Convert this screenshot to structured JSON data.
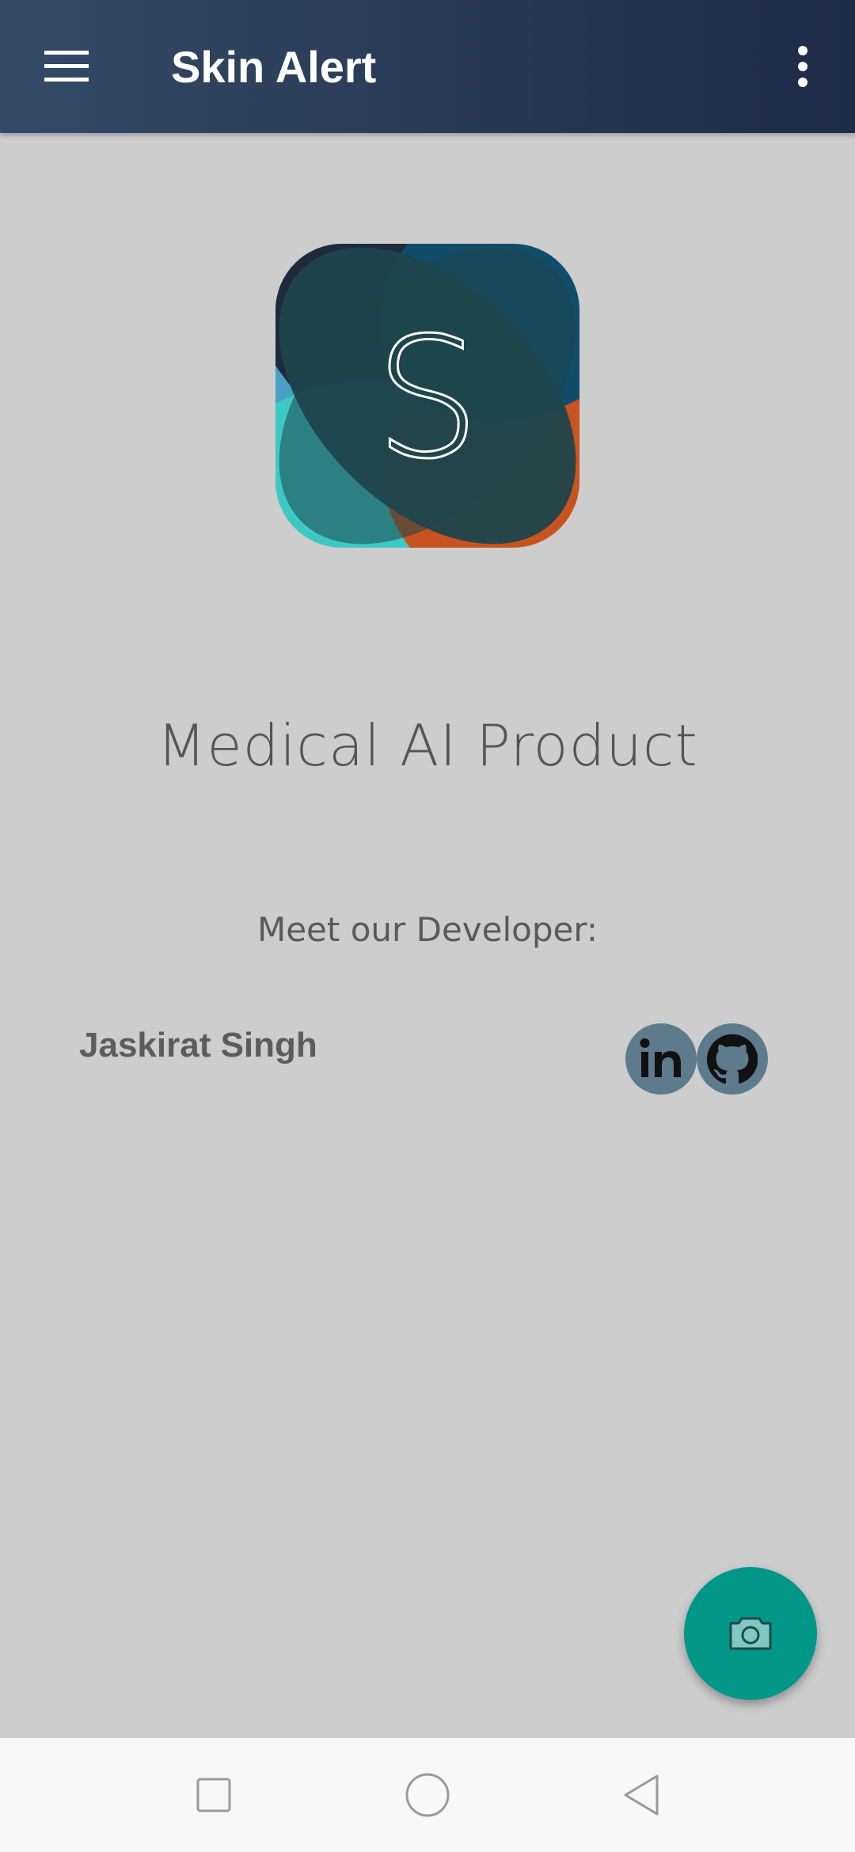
{
  "app_bar": {
    "title": "Skin Alert",
    "menu_icon": "hamburger-menu-icon",
    "overflow_icon": "more-vert-icon",
    "background_start": "#344a66",
    "background_end": "#1d2b47"
  },
  "logo": {
    "letter": "S",
    "icon": "app-logo"
  },
  "content": {
    "tagline": "Medical AI Product",
    "meet_heading": "Meet our Developer:",
    "developer_name": "Jaskirat Singh",
    "linkedin_icon": "linkedin-icon",
    "github_icon": "github-icon"
  },
  "fab": {
    "icon": "camera-icon",
    "color": "#009688"
  },
  "nav_bar": {
    "recent_icon": "square-recents-icon",
    "home_icon": "circle-home-icon",
    "back_icon": "triangle-back-icon"
  }
}
